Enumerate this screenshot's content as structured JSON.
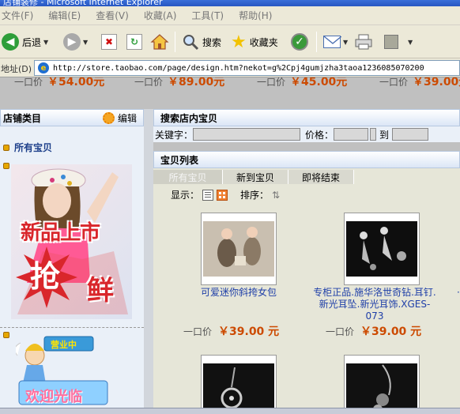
{
  "window": {
    "title": "店铺装修 - Microsoft Internet Explorer"
  },
  "menu": [
    "文件(F)",
    "编辑(E)",
    "查看(V)",
    "收藏(A)",
    "工具(T)",
    "帮助(H)"
  ],
  "toolbar": {
    "back_label": "后退",
    "search_label": "搜索",
    "favorites_label": "收藏夹"
  },
  "address": {
    "label": "地址(D)",
    "url": "http://store.taobao.com/page/design.htm?nekot=g%2Cpj4gumjzha3taoa1236085070200"
  },
  "prev_prices": [
    {
      "label": "一口价",
      "value": "￥54.00元"
    },
    {
      "label": "一口价",
      "value": "￥89.00元"
    },
    {
      "label": "一口价",
      "value": "￥45.00元"
    },
    {
      "label": "一口价",
      "value": "￥39.00元"
    }
  ],
  "sidebar": {
    "title": "店铺类目",
    "edit_label": "编辑",
    "all_items_label": "所有宝贝",
    "banner1": {
      "line1": "新品上市",
      "line2": "抢",
      "line3": "鲜"
    },
    "banner2": {
      "sign": "营业中",
      "greeting": "欢迎光临"
    }
  },
  "search": {
    "title": "搜索店内宝贝",
    "keyword_label": "关键字：",
    "price_label": "价格：",
    "to_label": "到"
  },
  "list": {
    "title": "宝贝列表",
    "tabs": [
      "所有宝贝",
      "新到宝贝",
      "即将结束"
    ],
    "display_label": "显示：",
    "sort_label": "排序：",
    "items": [
      {
        "name": "可爱迷你斜挎女包",
        "price_label": "一口价",
        "price": "￥39.00 元"
      },
      {
        "name": "专柜正品.施华洛世奇钻.耳钉.新光耳坠.新光耳饰.XGES-073",
        "price_label": "一口价",
        "price": "￥39.00 元"
      }
    ]
  },
  "colors": {
    "accent": "#cc4a00",
    "link": "#1f3fa8",
    "panel": "#eaf0f8"
  }
}
